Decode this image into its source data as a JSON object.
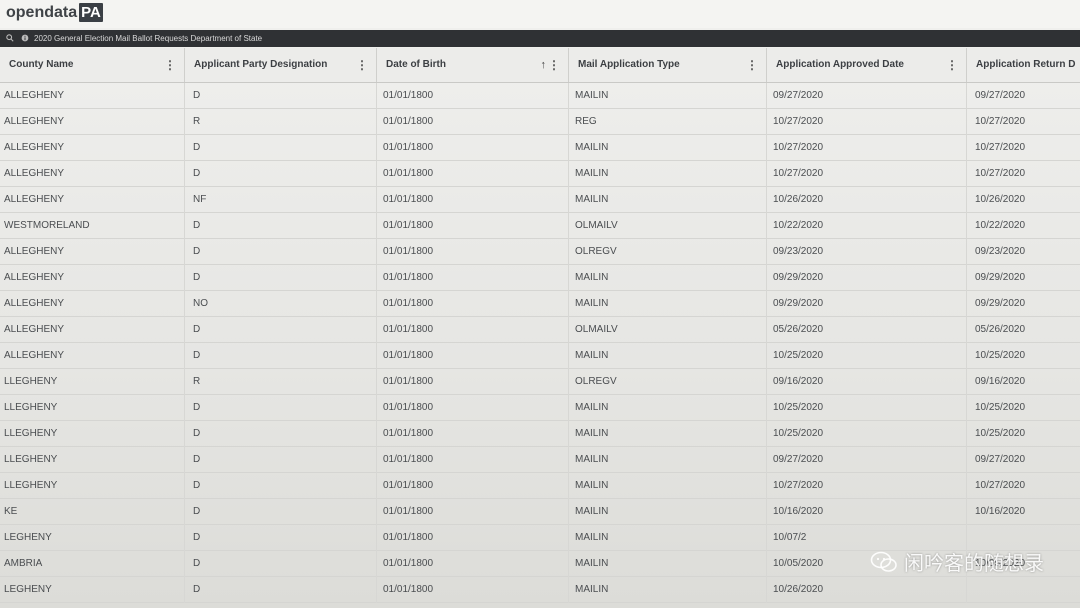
{
  "brand": {
    "prefix": "opendata",
    "suffix": "PA"
  },
  "dataset_title": "2020 General Election Mail Ballot Requests Department of State",
  "columns": [
    {
      "label": "County Name"
    },
    {
      "label": "Applicant Party Designation"
    },
    {
      "label": "Date of Birth"
    },
    {
      "label": "Mail Application Type"
    },
    {
      "label": "Application Approved Date"
    },
    {
      "label": "Application Return D"
    }
  ],
  "rows": [
    [
      "ALLEGHENY",
      "D",
      "01/01/1800",
      "MAILIN",
      "09/27/2020",
      "09/27/2020"
    ],
    [
      "ALLEGHENY",
      "R",
      "01/01/1800",
      "REG",
      "10/27/2020",
      "10/27/2020"
    ],
    [
      "ALLEGHENY",
      "D",
      "01/01/1800",
      "MAILIN",
      "10/27/2020",
      "10/27/2020"
    ],
    [
      "ALLEGHENY",
      "D",
      "01/01/1800",
      "MAILIN",
      "10/27/2020",
      "10/27/2020"
    ],
    [
      "ALLEGHENY",
      "NF",
      "01/01/1800",
      "MAILIN",
      "10/26/2020",
      "10/26/2020"
    ],
    [
      "WESTMORELAND",
      "D",
      "01/01/1800",
      "OLMAILV",
      "10/22/2020",
      "10/22/2020"
    ],
    [
      "ALLEGHENY",
      "D",
      "01/01/1800",
      "OLREGV",
      "09/23/2020",
      "09/23/2020"
    ],
    [
      "ALLEGHENY",
      "D",
      "01/01/1800",
      "MAILIN",
      "09/29/2020",
      "09/29/2020"
    ],
    [
      "ALLEGHENY",
      "NO",
      "01/01/1800",
      "MAILIN",
      "09/29/2020",
      "09/29/2020"
    ],
    [
      "ALLEGHENY",
      "D",
      "01/01/1800",
      "OLMAILV",
      "05/26/2020",
      "05/26/2020"
    ],
    [
      "ALLEGHENY",
      "D",
      "01/01/1800",
      "MAILIN",
      "10/25/2020",
      "10/25/2020"
    ],
    [
      "LLEGHENY",
      "R",
      "01/01/1800",
      "OLREGV",
      "09/16/2020",
      "09/16/2020"
    ],
    [
      "LLEGHENY",
      "D",
      "01/01/1800",
      "MAILIN",
      "10/25/2020",
      "10/25/2020"
    ],
    [
      "LLEGHENY",
      "D",
      "01/01/1800",
      "MAILIN",
      "10/25/2020",
      "10/25/2020"
    ],
    [
      "LLEGHENY",
      "D",
      "01/01/1800",
      "MAILIN",
      "09/27/2020",
      "09/27/2020"
    ],
    [
      "LLEGHENY",
      "D",
      "01/01/1800",
      "MAILIN",
      "10/27/2020",
      "10/27/2020"
    ],
    [
      "KE",
      "D",
      "01/01/1800",
      "MAILIN",
      "10/16/2020",
      "10/16/2020"
    ],
    [
      "LEGHENY",
      "D",
      "01/01/1800",
      "MAILIN",
      "10/07/2",
      ""
    ],
    [
      "AMBRIA",
      "D",
      "01/01/1800",
      "MAILIN",
      "10/05/2020",
      "10/05/2020"
    ],
    [
      "LEGHENY",
      "D",
      "01/01/1800",
      "MAILIN",
      "10/26/2020",
      ""
    ]
  ],
  "watermark": "闲吟客的随想录",
  "icons": {
    "search": "search-icon",
    "info": "info-icon",
    "sort": "sort-ascending-icon",
    "menu": "column-menu-icon",
    "watermark": "wechat-icon"
  }
}
